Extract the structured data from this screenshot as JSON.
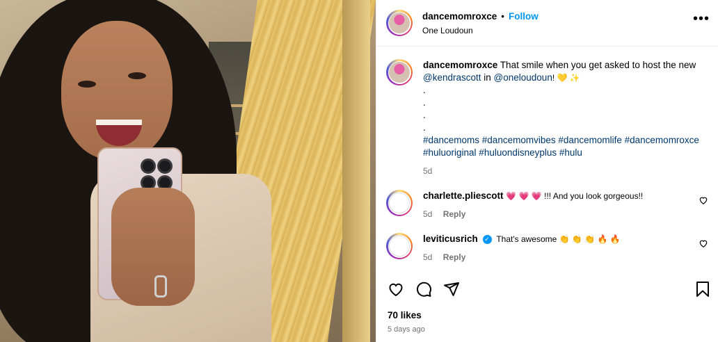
{
  "post": {
    "username": "dancemomroxce",
    "follow_label": "Follow",
    "location": "One Loudoun",
    "separator": "•"
  },
  "caption": {
    "username": "dancemomroxce",
    "text_before": "That smile when you get asked to host the new",
    "mention1": "@kendrascott",
    "in_word": "in",
    "mention2": "@oneloudoun",
    "text_after": "! 💛 ✨",
    "dots": [
      ".",
      ".",
      ".",
      "."
    ],
    "hashtags_line1": "#dancemoms #dancemomvibes #dancemomlife #dancemomroxce",
    "hashtags_line2": "#huluoriginal #huluondisneyplus #hulu",
    "time": "5d"
  },
  "comments": [
    {
      "username": "charlette.pliescott",
      "text": "💗 💗 💗 !!! And you look gorgeous!!",
      "time": "5d",
      "reply_label": "Reply",
      "verified": false
    },
    {
      "username": "leviticusrich",
      "text": "That's awesome 👏 👏 👏 🔥 🔥",
      "time": "5d",
      "reply_label": "Reply",
      "verified": true
    }
  ],
  "footer": {
    "likes": "70 likes",
    "time_ago": "5 days ago"
  },
  "icons": {
    "like": "heart-icon",
    "comment": "comment-icon",
    "share": "send-icon",
    "save": "bookmark-icon",
    "more": "more-options-icon"
  },
  "colors": {
    "link": "#00376b",
    "follow": "#0095f6",
    "muted": "#737373"
  }
}
